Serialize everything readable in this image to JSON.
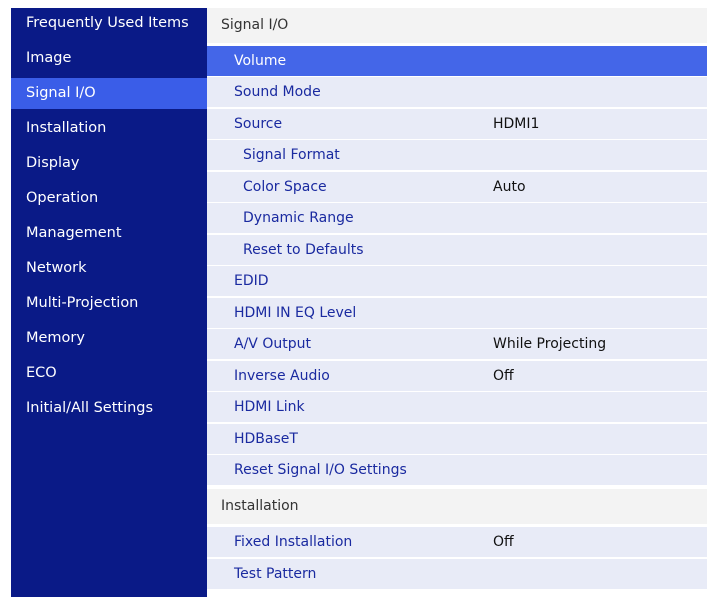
{
  "sidebar": {
    "items": [
      {
        "label": "Frequently Used Items"
      },
      {
        "label": "Image"
      },
      {
        "label": "Signal I/O"
      },
      {
        "label": "Installation"
      },
      {
        "label": "Display"
      },
      {
        "label": "Operation"
      },
      {
        "label": "Management"
      },
      {
        "label": "Network"
      },
      {
        "label": "Multi-Projection"
      },
      {
        "label": "Memory"
      },
      {
        "label": "ECO"
      },
      {
        "label": "Initial/All Settings"
      }
    ],
    "active_index": 2
  },
  "main": {
    "signal_section": {
      "title": "Signal I/O",
      "rows": [
        {
          "label": "Volume",
          "value": ""
        },
        {
          "label": "Sound Mode",
          "value": ""
        },
        {
          "label": "Source",
          "value": "HDMI1"
        },
        {
          "label": "Signal Format",
          "value": ""
        },
        {
          "label": "Color Space",
          "value": "Auto"
        },
        {
          "label": "Dynamic Range",
          "value": ""
        },
        {
          "label": "Reset to Defaults",
          "value": ""
        },
        {
          "label": "EDID",
          "value": ""
        },
        {
          "label": "HDMI IN EQ Level",
          "value": ""
        },
        {
          "label": "A/V Output",
          "value": "While Projecting"
        },
        {
          "label": "Inverse Audio",
          "value": "Off"
        },
        {
          "label": "HDMI Link",
          "value": ""
        },
        {
          "label": "HDBaseT",
          "value": ""
        },
        {
          "label": "Reset Signal I/O Settings",
          "value": ""
        }
      ]
    },
    "installation_section": {
      "title": "Installation",
      "rows": [
        {
          "label": "Fixed Installation",
          "value": "Off"
        },
        {
          "label": "Test Pattern",
          "value": ""
        }
      ]
    }
  },
  "colors": {
    "sidebar_bg": "#0a1a87",
    "sidebar_active": "#3a5de8",
    "row_bg": "#e8ebf7",
    "row_active": "#4466e8",
    "row_text": "#1a2aa0"
  }
}
